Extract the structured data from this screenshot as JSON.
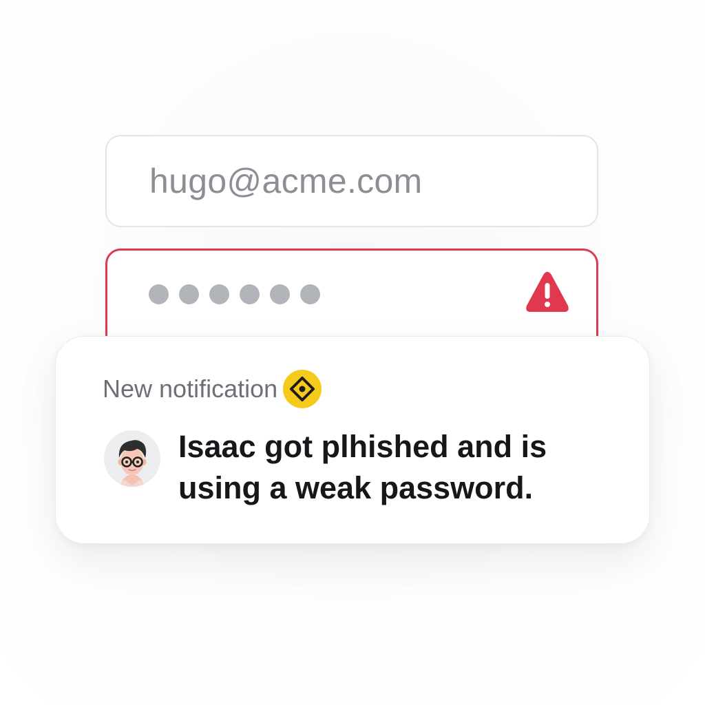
{
  "login_form": {
    "email_value": "hugo@acme.com",
    "password_mask_count": 6,
    "password_state": "error",
    "error_icon": "warning-triangle-icon"
  },
  "notification": {
    "title": "New notification",
    "badge_icon": "diamond-badge-icon",
    "avatar": "person-avatar",
    "message": "Isaac got plhished and is using a weak password."
  },
  "colors": {
    "error_red": "#e0394f",
    "badge_yellow": "#f5ca1b",
    "text_dark": "#16171a",
    "text_muted": "#6c6f76",
    "placeholder_gray": "#8b8e95",
    "dot_gray": "#b1b5ba"
  }
}
